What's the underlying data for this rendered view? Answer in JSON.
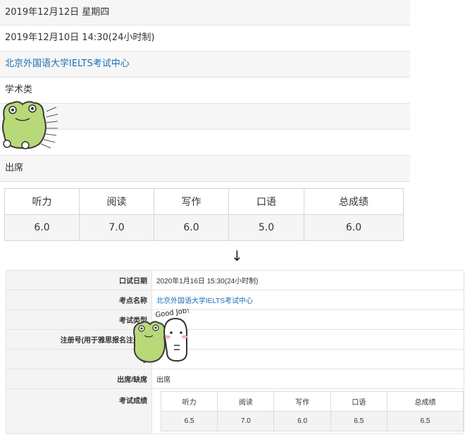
{
  "top": {
    "rows": [
      "2019年12月12日 星期四",
      "2019年12月10日 14:30(24小时制)",
      "北京外国语大学IELTS考试中心",
      "学术类",
      "",
      "",
      "出席"
    ],
    "scores": {
      "headers": [
        "听力",
        "阅读",
        "写作",
        "口语",
        "总成绩"
      ],
      "values": [
        "6.0",
        "7.0",
        "6.0",
        "5.0",
        "6.0"
      ]
    }
  },
  "arrow": "↓",
  "bottom": {
    "rows": [
      {
        "label": "口试日期",
        "value": "2020年1月16日 15:30(24小时制)"
      },
      {
        "label": "考点名称",
        "value": "北京外国语大学IELTS考试中心"
      },
      {
        "label": "考试类型",
        "value": ""
      },
      {
        "label": "注册号(用于雅思报名注册过",
        "value": ""
      },
      {
        "label": "考",
        "value": ""
      },
      {
        "label": "出席/缺席",
        "value": "出席"
      },
      {
        "label": "考试成绩",
        "value": ""
      }
    ],
    "scores": {
      "headers": [
        "听力",
        "阅读",
        "写作",
        "口语",
        "总成绩"
      ],
      "values": [
        "6.5",
        "7.0",
        "6.0",
        "6.5",
        "6.5"
      ]
    }
  },
  "sticker_text": "Good Job!",
  "colors": {
    "link": "#1a6fb5",
    "row_shade": "#f6f6f6",
    "frog": "#b8d97a"
  }
}
